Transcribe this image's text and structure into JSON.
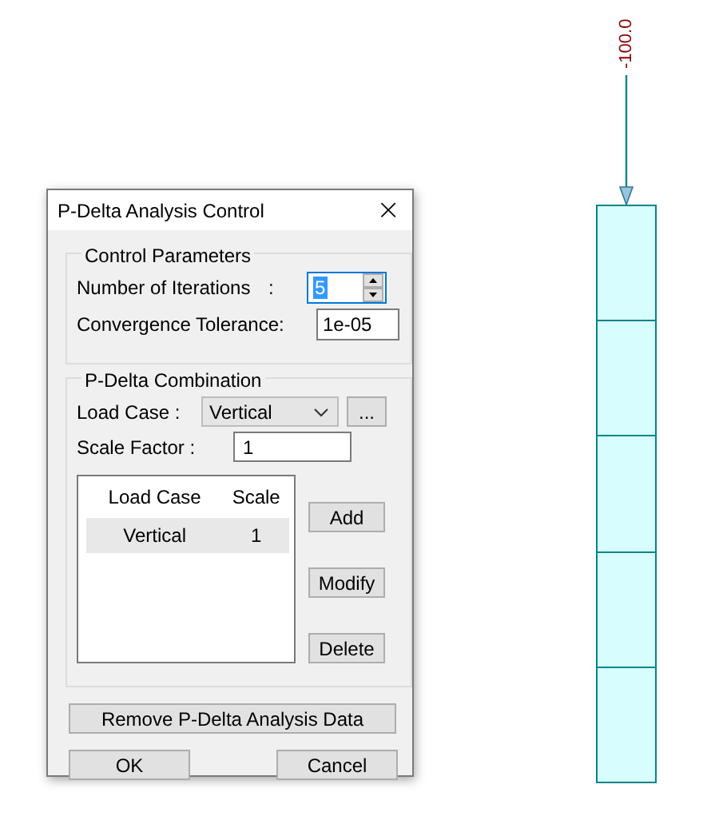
{
  "dialog": {
    "title": "P-Delta Analysis Control",
    "close": "×"
  },
  "control_parameters": {
    "legend": "Control Parameters",
    "iterations": {
      "label": "Number of Iterations",
      "colon": ":",
      "value": "5",
      "focused": true
    },
    "tolerance": {
      "label": "Convergence Tolerance:",
      "value": "1e-05"
    }
  },
  "combination": {
    "legend": "P-Delta Combination",
    "load_case": {
      "label": "Load Case :",
      "value": "Vertical",
      "browse": "..."
    },
    "scale_factor": {
      "label": "Scale Factor :",
      "value": "1"
    },
    "table": {
      "columns": [
        "Load Case",
        "Scale"
      ],
      "rows": [
        {
          "cells": [
            "Vertical",
            "1"
          ],
          "selected": true
        }
      ]
    },
    "buttons": [
      "Add",
      "Modify",
      "Delete"
    ]
  },
  "remove_button": "Remove P-Delta Analysis Data",
  "footer_buttons": [
    "OK",
    "Cancel"
  ],
  "model": {
    "load_label": "-100.0"
  }
}
